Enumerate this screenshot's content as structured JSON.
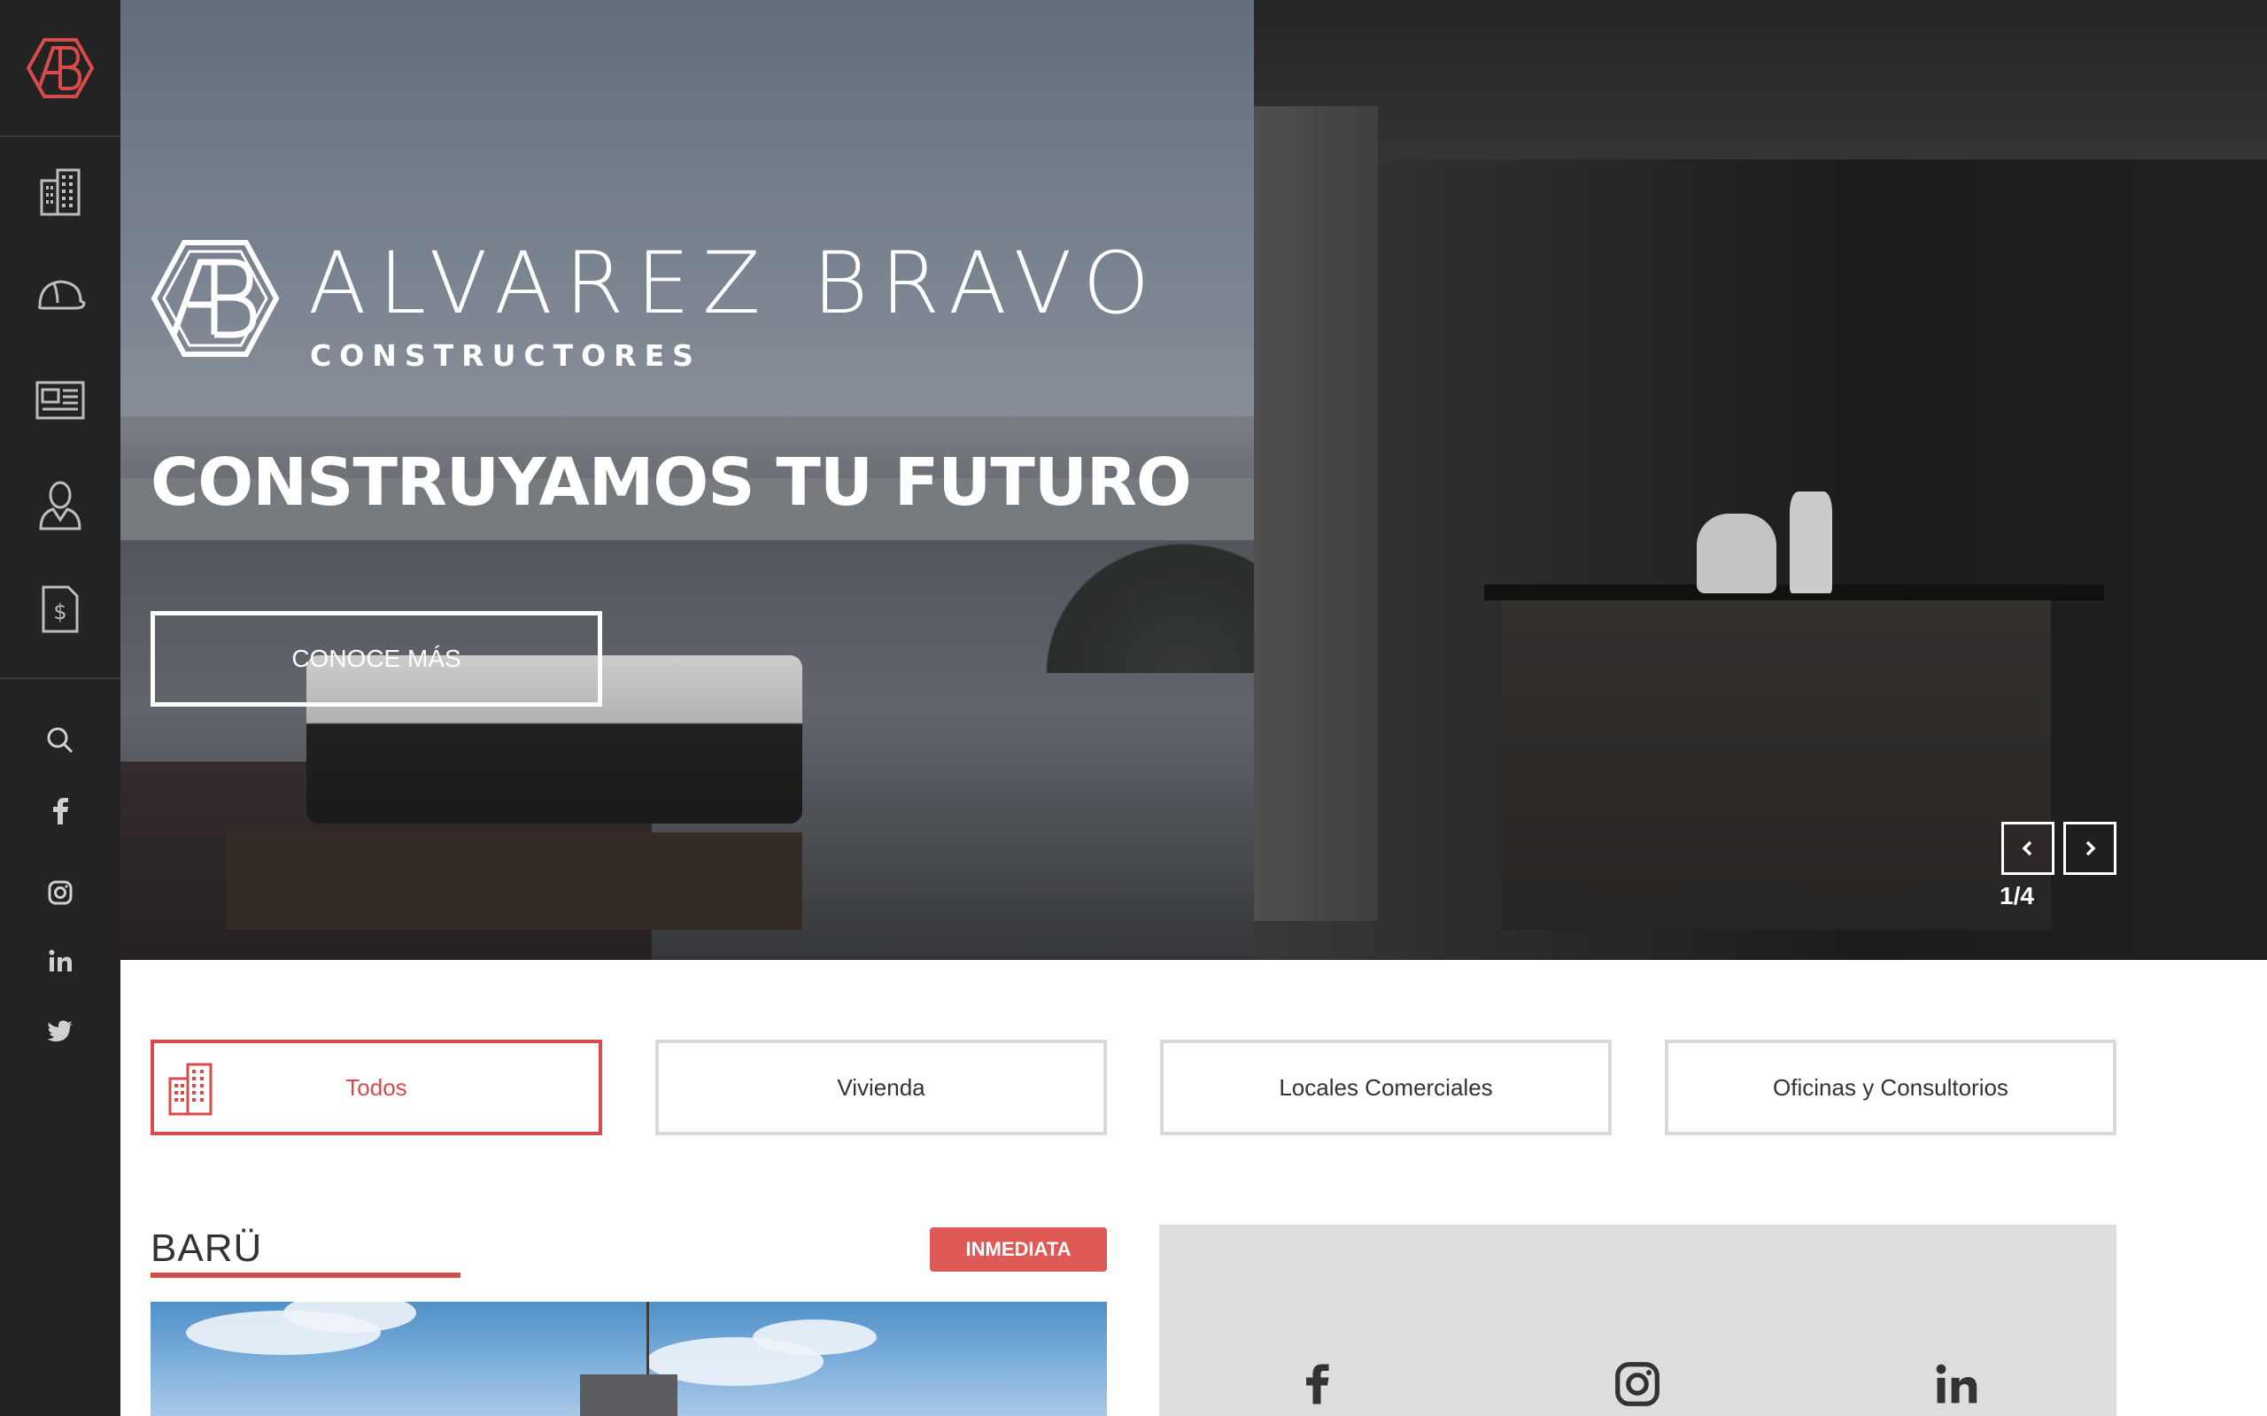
{
  "sidebar": {
    "logo_text": "AB",
    "nav": [
      {
        "icon": "buildings-icon",
        "name": "proyectos"
      },
      {
        "icon": "hard-hat-icon",
        "name": "constructora"
      },
      {
        "icon": "newspaper-icon",
        "name": "noticias"
      },
      {
        "icon": "person-icon",
        "name": "contacto"
      },
      {
        "icon": "money-document-icon",
        "name": "cotizacion"
      }
    ],
    "social": [
      "search-icon",
      "facebook-icon",
      "instagram-icon",
      "linkedin-icon",
      "twitter-icon"
    ]
  },
  "hero": {
    "brand_name": "ALVAREZ BRAVO",
    "brand_sub": "CONSTRUCTORES",
    "title": "CONSTRUYAMOS TU FUTURO",
    "cta": "CONOCE MÁS",
    "slide_counter": "1/4"
  },
  "filters": [
    {
      "label": "Todos",
      "active": true
    },
    {
      "label": "Vivienda",
      "active": false
    },
    {
      "label": "Locales Comerciales",
      "active": false
    },
    {
      "label": "Oficinas y Consultorios",
      "active": false
    }
  ],
  "project": {
    "name": "BARÜ",
    "badge": "INMEDIATA"
  },
  "colors": {
    "sidebar_bg": "#232323",
    "accent": "#d94b4b",
    "badge": "#e05a55",
    "panel_bg": "#dddddd"
  }
}
